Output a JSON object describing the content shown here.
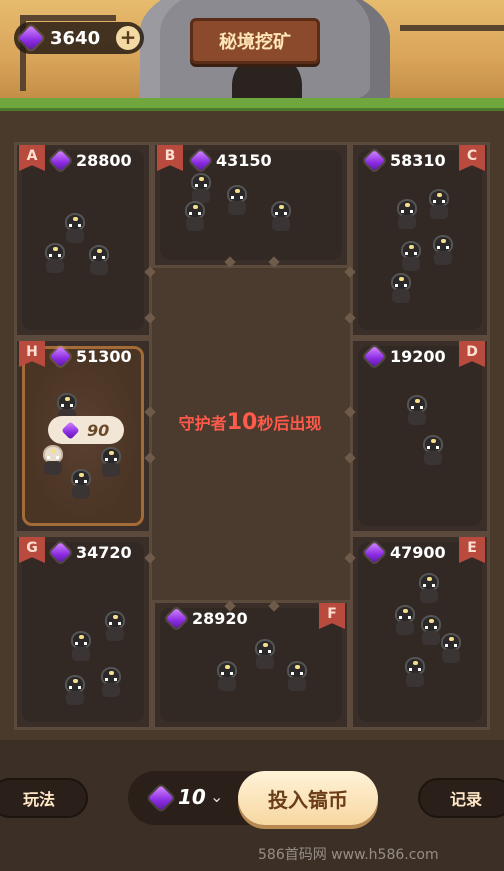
{
  "header": {
    "gem_balance": "3640",
    "plus_label": "+",
    "title": "秘境挖矿"
  },
  "rooms": [
    {
      "id": "A",
      "value": "28800"
    },
    {
      "id": "B",
      "value": "43150"
    },
    {
      "id": "C",
      "value": "58310"
    },
    {
      "id": "H",
      "value": "51300"
    },
    {
      "id": "D",
      "value": "19200"
    },
    {
      "id": "G",
      "value": "34720"
    },
    {
      "id": "F",
      "value": "28920"
    },
    {
      "id": "E",
      "value": "47900"
    }
  ],
  "my_bet": "90",
  "center_message": {
    "prefix": "守护者",
    "seconds": "10",
    "suffix": "秒后出现"
  },
  "bottom": {
    "rules_label": "玩法",
    "bet_amount": "10",
    "invest_label": "投入镐币",
    "records_label": "记录"
  },
  "watermark": "586首码网 www.h586.com"
}
